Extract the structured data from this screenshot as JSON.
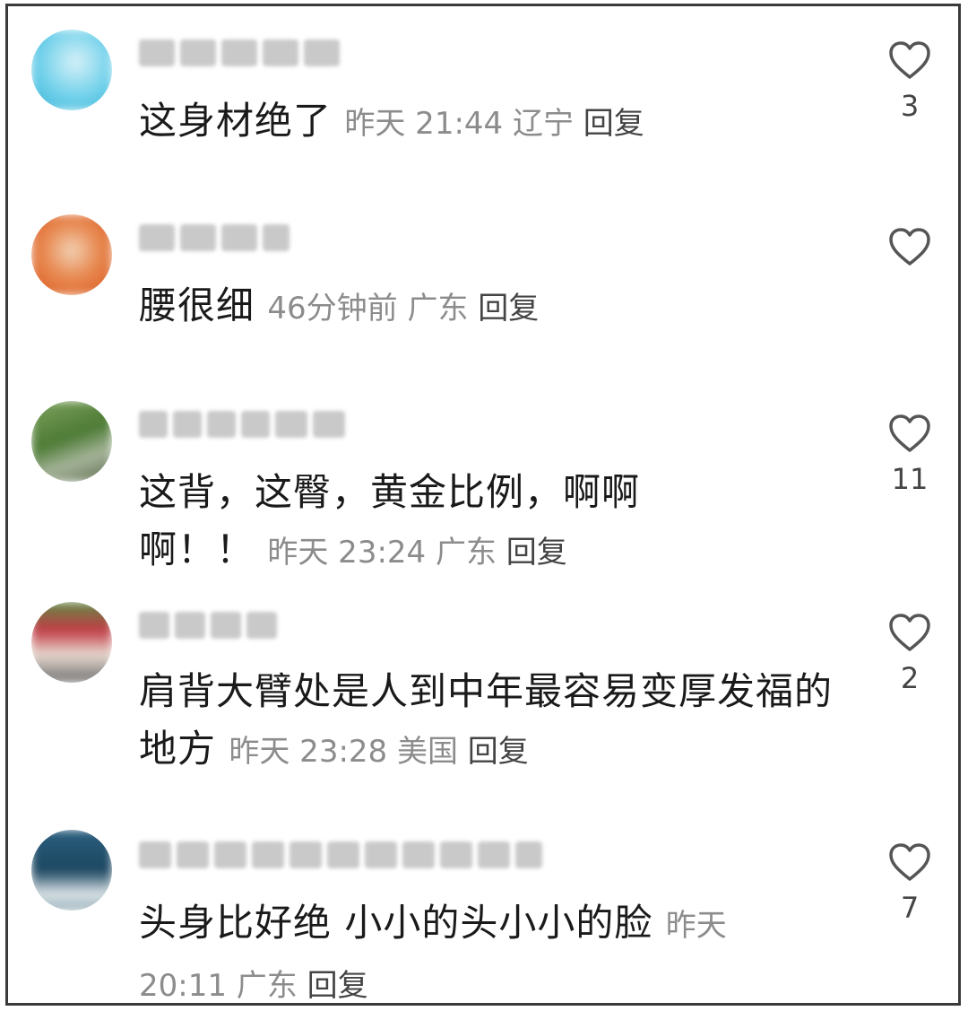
{
  "comments": [
    {
      "text": "这身材绝了",
      "time": "昨天 21:44",
      "location": "辽宁",
      "reply": "回复",
      "likes": "3",
      "avatar_colors": [
        "#5ec8e6",
        "#cfeef7"
      ]
    },
    {
      "text": "腰很细",
      "time": "46分钟前",
      "location": "广东",
      "reply": "回复",
      "likes": "",
      "avatar_colors": [
        "#e2682c",
        "#f3c7a6"
      ]
    },
    {
      "text": "这背，这臀，黄金比例，啊啊啊！！",
      "time": "昨天 23:24",
      "location": "广东",
      "reply": "回复",
      "likes": "11",
      "avatar_colors": [
        "#4f7d3a",
        "#9cb089"
      ]
    },
    {
      "text": "肩背大臂处是人到中年最容易变厚发福的地方",
      "time": "昨天 23:28",
      "location": "美国",
      "reply": "回复",
      "likes": "2",
      "avatar_colors": [
        "#c7424a",
        "#d9d2c9"
      ]
    },
    {
      "text": "头身比好绝 小小的头小小的脸",
      "time": "昨天 20:11",
      "location": "广东",
      "reply": "回复",
      "likes": "7",
      "avatar_colors": [
        "#1e4f6b",
        "#8fb6c8"
      ]
    }
  ]
}
